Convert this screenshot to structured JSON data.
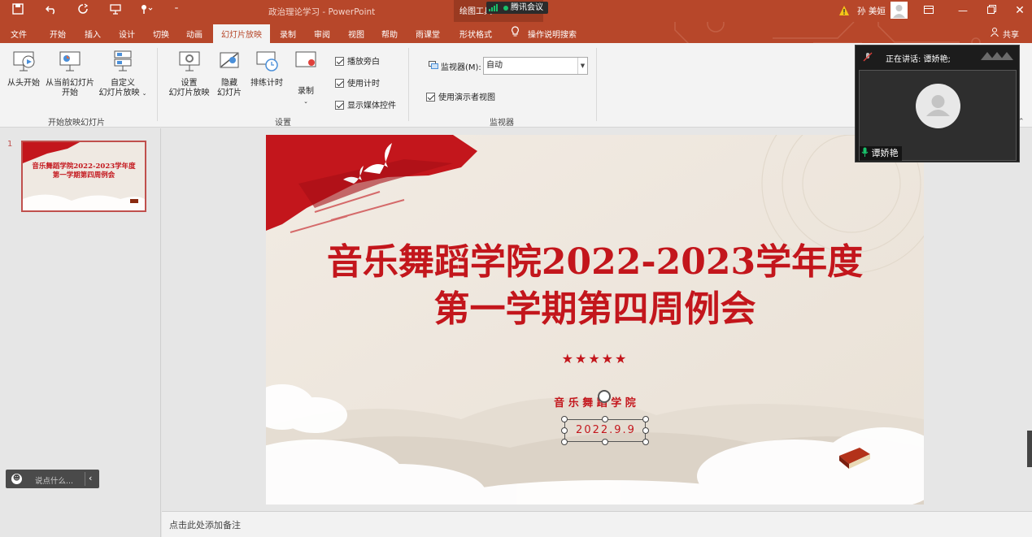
{
  "window": {
    "doc_title": "政治理论学习 - PowerPoint",
    "context_tools_label": "绘图工具",
    "meeting_label": "腾讯会议",
    "user_name": "孙 美姮"
  },
  "tabs": [
    "文件",
    "开始",
    "插入",
    "设计",
    "切换",
    "动画",
    "幻灯片放映",
    "录制",
    "审阅",
    "视图",
    "帮助",
    "雨课堂",
    "形状格式"
  ],
  "active_tab": "幻灯片放映",
  "tell_me": "操作说明搜索",
  "share": "共享",
  "ribbon": {
    "group_start": {
      "label": "开始放映幻灯片",
      "from_beginning": "从头开始",
      "from_current_1": "从当前幻灯片",
      "from_current_2": "开始",
      "custom_1": "自定义",
      "custom_2": "幻灯片放映"
    },
    "group_setup": {
      "label": "设置",
      "setup_1": "设置",
      "setup_2": "幻灯片放映",
      "hide_1": "隐藏",
      "hide_2": "幻灯片",
      "rehearse": "排练计时",
      "record": "录制",
      "play_narration": "播放旁白",
      "use_timings": "使用计时",
      "show_media": "显示媒体控件"
    },
    "group_monitor": {
      "label": "监视器",
      "monitor_label": "监视器(M):",
      "monitor_value": "自动",
      "presenter_view": "使用演示者视图"
    }
  },
  "thumbnail": {
    "number": "1",
    "title_line1": "音乐舞蹈学院2022-2023学年度",
    "title_line2": "第一学期第四周例会"
  },
  "slide": {
    "title_line1": "音乐舞蹈学院2022-2023学年度",
    "title_line2": "第一学期第四周例会",
    "stars": "★★★★★",
    "subtitle": "音 乐 舞 蹈 学 院",
    "date": "2022.9.9"
  },
  "chat_placeholder": "说点什么...",
  "notes_placeholder": "点击此处添加备注",
  "meeting": {
    "speaking_label": "正在讲话: 谭娇艳;",
    "participant_name": "谭娇艳"
  },
  "colors": {
    "accent": "#b7472a",
    "slide_red": "#c3161c"
  }
}
